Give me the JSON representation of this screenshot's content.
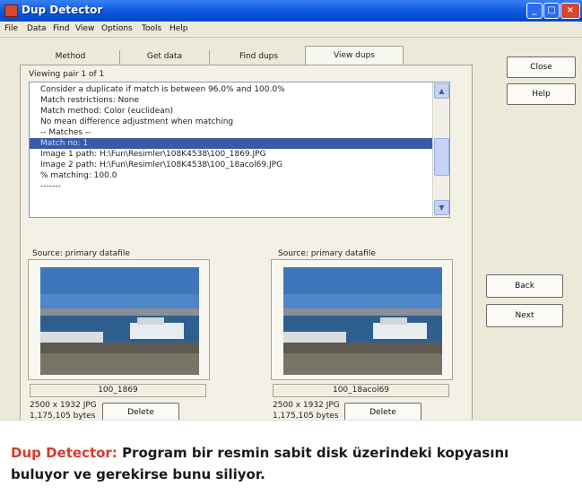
{
  "window": {
    "title": "Dup Detector"
  },
  "menu": [
    "File",
    "Data",
    "Find",
    "View",
    "Options",
    "Tools",
    "Help"
  ],
  "tabs": [
    {
      "label": "Method"
    },
    {
      "label": "Get data"
    },
    {
      "label": "Find dups"
    },
    {
      "label": "View dups",
      "active": true
    }
  ],
  "side_buttons": {
    "close": "Close",
    "help": "Help",
    "back": "Back",
    "next": "Next"
  },
  "viewing": "Viewing pair 1 of 1",
  "list": [
    "Consider a duplicate if match is between 96.0% and 100.0%",
    "Match restrictions: None",
    "Match method: Color (euclidean)",
    "No mean difference adjustment when matching",
    "-- Matches --",
    "Match no: 1",
    "Image 1 path: H:\\Fun\\Resimler\\108K4538\\100_1869.JPG",
    "Image 2 path: H:\\Fun\\Resimler\\108K4538\\100_18acol69.JPG",
    "% matching: 100.0",
    "-------"
  ],
  "selected_index": 5,
  "left": {
    "source": "Source: primary datafile",
    "filename": "100_1869",
    "info1": "2500 x 1932 JPG",
    "info2": "1,175,105 bytes",
    "delete": "Delete"
  },
  "right": {
    "source": "Source: primary datafile",
    "filename": "100_18acol69",
    "info1": "2500 x 1932 JPG",
    "info2": "1,175,105 bytes",
    "delete": "Delete"
  },
  "caption": {
    "title": "Dup Detector:",
    "text": "Program bir resmin sabit disk üzerindeki kopyasını buluyor ve gerekirse bunu siliyor."
  },
  "colors": {
    "accent": "#d63a2b",
    "selection": "#3a5aa8",
    "titlebar": "#0a58e0"
  }
}
